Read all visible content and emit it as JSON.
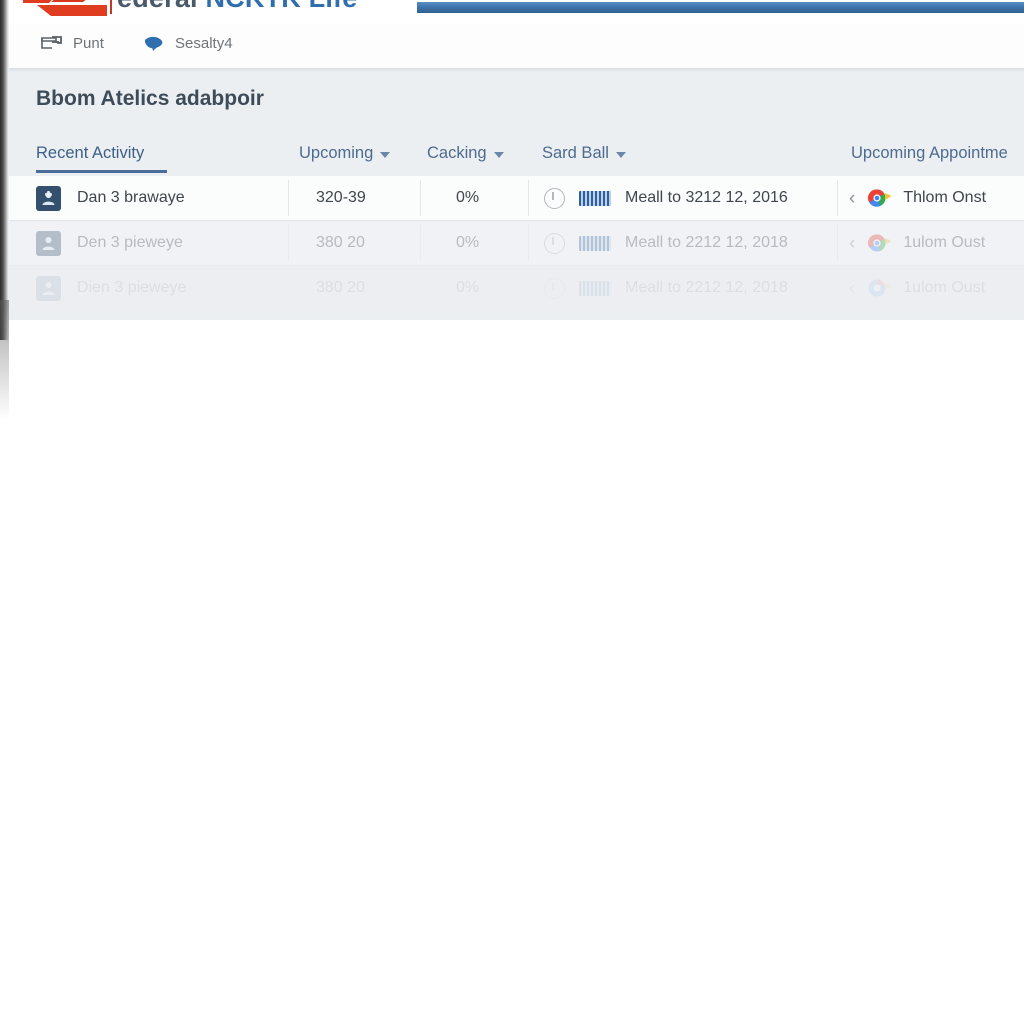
{
  "brand": {
    "logo_icon": "angular-arrow-logo",
    "title_part1": "ederal ",
    "title_part2": "NCKTK Life",
    "divider_icon": "vertical-rule"
  },
  "nav": {
    "items": [
      {
        "label": "Punt",
        "icon": "printer-icon"
      },
      {
        "label": "Sesalty4",
        "icon": "bird-icon"
      }
    ]
  },
  "page": {
    "title": "Bbom Atelics adabpoir"
  },
  "columns": [
    {
      "label": "Recent Activity",
      "active": true,
      "caret": false
    },
    {
      "label": "Upcoming",
      "active": false,
      "caret": true
    },
    {
      "label": "Cacking",
      "active": false,
      "caret": true
    },
    {
      "label": "Sard Ball",
      "active": false,
      "caret": true
    },
    {
      "label": "Upcoming Appointme",
      "active": false,
      "caret": false
    }
  ],
  "rows": [
    {
      "name": "Dan 3 brawaye",
      "code": "320-39",
      "percent": "0%",
      "note": "Meall to 3212 12, 2016",
      "appointment": "Thlom Onst",
      "name_icon": "user-badge-icon",
      "status_icon": "clock-icon",
      "tag_icon": "barcode-icon",
      "back_icon": "chevron-left-icon",
      "brand_icon": "chrome-logo-icon"
    },
    {
      "name": "Den 3 pieweye",
      "code": "380 20",
      "percent": "0%",
      "note": "Meall to 2212 12, 2018",
      "appointment": "1ulom Oust",
      "name_icon": "user-badge-icon",
      "status_icon": "clock-icon",
      "tag_icon": "barcode-icon",
      "back_icon": "chevron-left-icon",
      "brand_icon": "chrome-logo-icon"
    },
    {
      "name": "Dien 3 pieweye",
      "code": "380 20",
      "percent": "0%",
      "note": "Meall to 2212 12, 2018",
      "appointment": "1ulom Oust",
      "name_icon": "user-badge-icon",
      "status_icon": "clock-icon",
      "tag_icon": "barcode-icon",
      "back_icon": "chevron-left-icon",
      "brand_icon": "chrome-logo-icon"
    }
  ],
  "colors": {
    "logo_red": "#e03c20",
    "accent_blue": "#3d74ad",
    "panel_bg": "#eceff2",
    "header_text": "#4d6b8f",
    "row_alert_bg": "#fbe9e9"
  }
}
